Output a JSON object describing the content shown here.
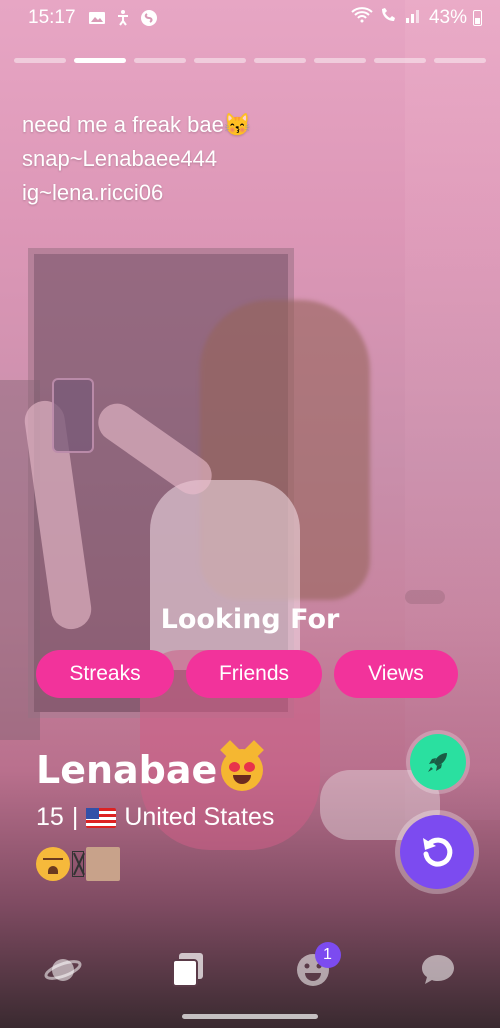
{
  "status_bar": {
    "time": "15:17",
    "battery": "43%",
    "left_icons": [
      "gallery-icon",
      "accessibility-icon",
      "shazam-icon"
    ],
    "right_icons": [
      "wifi-icon",
      "wifi-calling-icon",
      "signal-icon",
      "battery-icon"
    ]
  },
  "story": {
    "total": 8,
    "active_index": 1
  },
  "bio": {
    "line1": "need me a freak bae😽",
    "line2": "snap~Lenabaee444",
    "line3": "ig~lena.ricci06"
  },
  "looking_for": {
    "title": "Looking For",
    "tags": [
      "Streaks",
      "Friends",
      "Views"
    ]
  },
  "profile": {
    "name": "Lenabae",
    "age": "15",
    "separator": "|",
    "country": "United States"
  },
  "actions": {
    "boost_icon": "rocket-icon",
    "rewind_icon": "rewind-icon"
  },
  "nav": {
    "items": [
      "planet-icon",
      "cards-icon",
      "smiley-icon",
      "chat-icon"
    ],
    "badge_count": "1"
  },
  "colors": {
    "tag_bg": "#f2339b",
    "boost": "#2ae0a0",
    "rewind": "#7c4bf0"
  }
}
